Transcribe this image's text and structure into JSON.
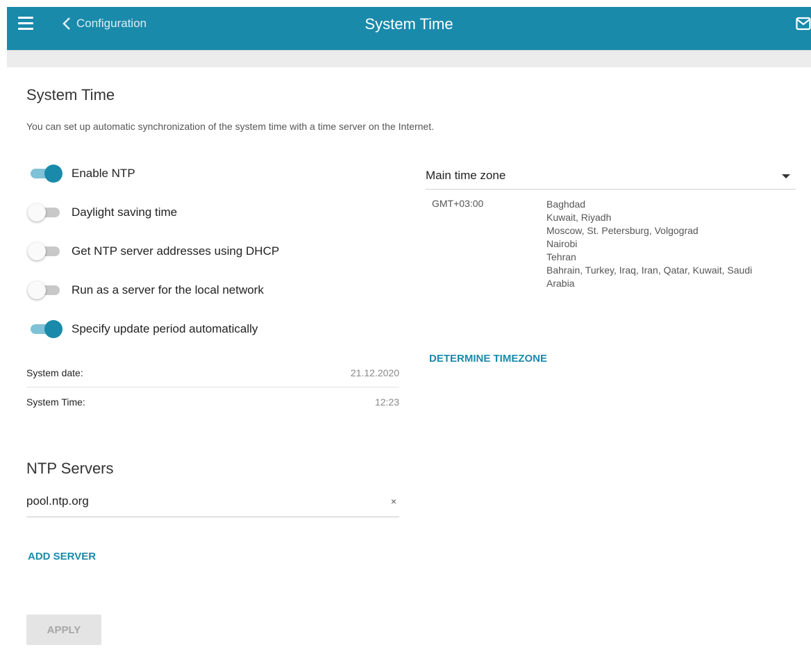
{
  "header": {
    "back_label": "Configuration",
    "title": "System Time",
    "menu_icon": "hamburger-icon",
    "back_icon": "chevron-left-icon",
    "mail_icon": "mail-icon"
  },
  "colors": {
    "accent": "#1a8aab",
    "toggle_track_on": "#7fc1d6",
    "toggle_track_off": "#c8c8c8"
  },
  "section": {
    "title": "System Time",
    "description": "You can set up automatic synchronization of the system time with a time server on the Internet."
  },
  "toggles": [
    {
      "label": "Enable NTP",
      "on": true
    },
    {
      "label": "Daylight saving time",
      "on": false
    },
    {
      "label": "Get NTP server addresses using DHCP",
      "on": false
    },
    {
      "label": "Run as a server for the local network",
      "on": false
    },
    {
      "label": "Specify update period automatically",
      "on": true
    }
  ],
  "system_info": {
    "date_label": "System date:",
    "date_value": "21.12.2020",
    "time_label": "System Time:",
    "time_value": "12:23"
  },
  "ntp": {
    "title": "NTP Servers",
    "server_value": "pool.ntp.org",
    "clear_glyph": "×",
    "add_label": "ADD SERVER"
  },
  "apply_label": "APPLY",
  "timezone": {
    "select_value": "Main time zone",
    "offset": "GMT+03:00",
    "cities": [
      "Baghdad",
      "Kuwait, Riyadh",
      "Moscow, St. Petersburg, Volgograd",
      "Nairobi",
      "Tehran",
      "Bahrain, Turkey, Iraq, Iran, Qatar, Kuwait, Saudi Arabia"
    ],
    "determine_label": "DETERMINE TIMEZONE"
  }
}
